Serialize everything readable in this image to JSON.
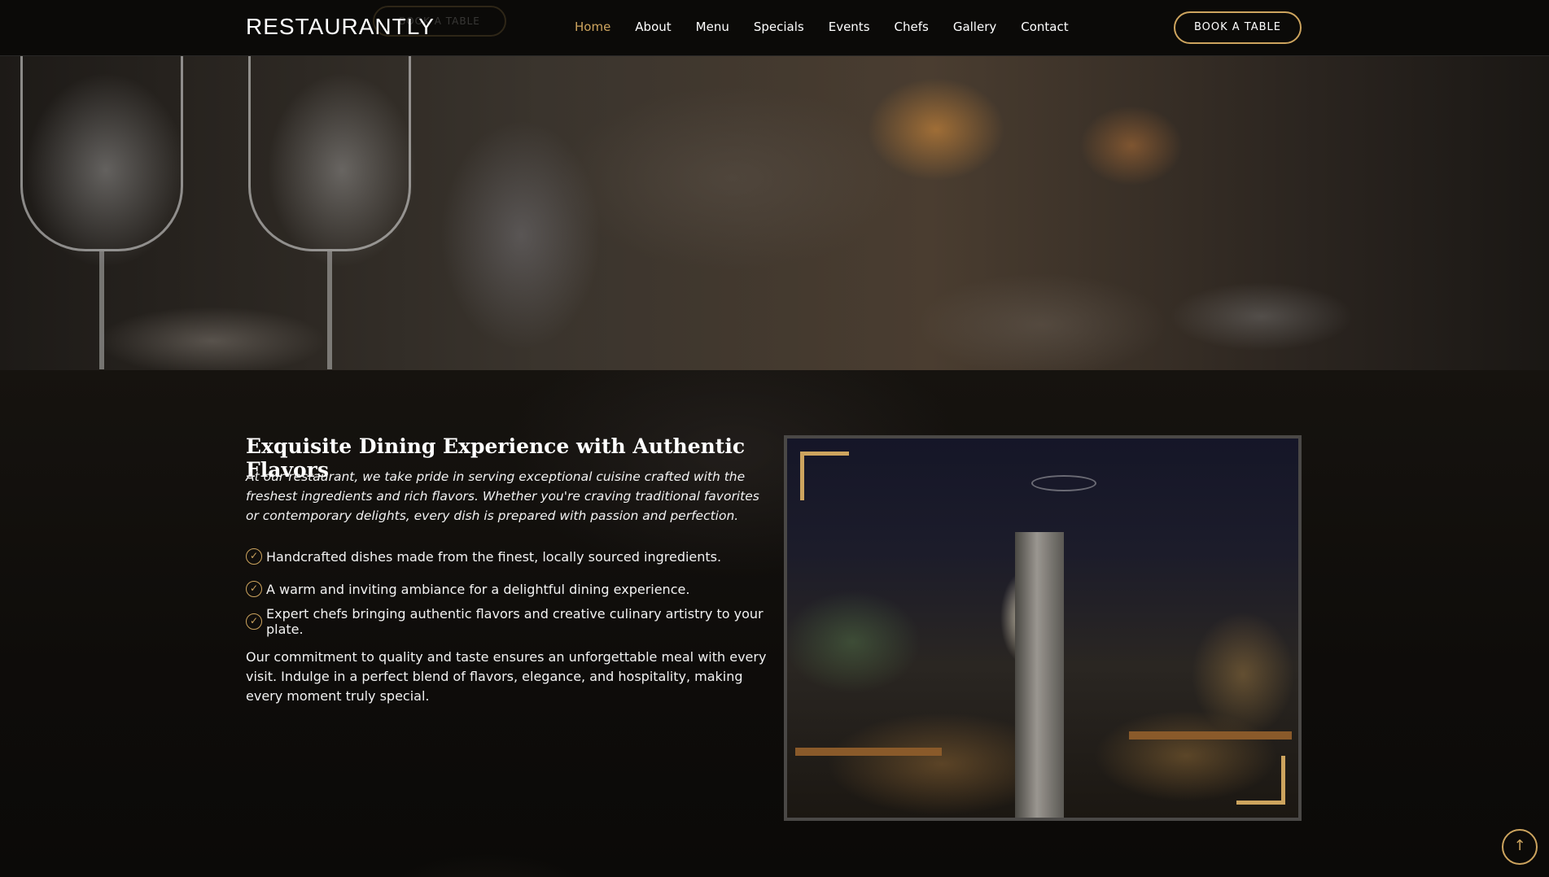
{
  "header": {
    "logo": "RESTAURANTLY",
    "ghost_button": "BOOK A TABLE",
    "nav": [
      {
        "label": "Home",
        "active": true
      },
      {
        "label": "About"
      },
      {
        "label": "Menu"
      },
      {
        "label": "Specials"
      },
      {
        "label": "Events"
      },
      {
        "label": "Chefs"
      },
      {
        "label": "Gallery"
      },
      {
        "label": "Contact"
      }
    ],
    "book_button": "BOOK A TABLE"
  },
  "about": {
    "heading": "Exquisite Dining Experience with Authentic Flavors",
    "intro": "At our restaurant, we take pride in serving exceptional cuisine crafted with the freshest ingredients and rich flavors. Whether you're craving traditional favorites or contemporary delights, every dish is prepared with passion and perfection.",
    "features": [
      "Handcrafted dishes made from the finest, locally sourced ingredients.",
      "A warm and inviting ambiance for a delightful dining experience.",
      "Expert chefs bringing authentic flavors and creative culinary artistry to your plate."
    ],
    "closing": "Our commitment to quality and taste ensures an unforgettable meal with every visit. Indulge in a perfect blend of flavors, elegance, and hospitality, making every moment truly special."
  },
  "icons": {
    "check": "check-circle-icon",
    "back_to_top": "arrow-up-icon"
  },
  "colors": {
    "accent": "#cda45e",
    "background": "#0c0b09"
  }
}
